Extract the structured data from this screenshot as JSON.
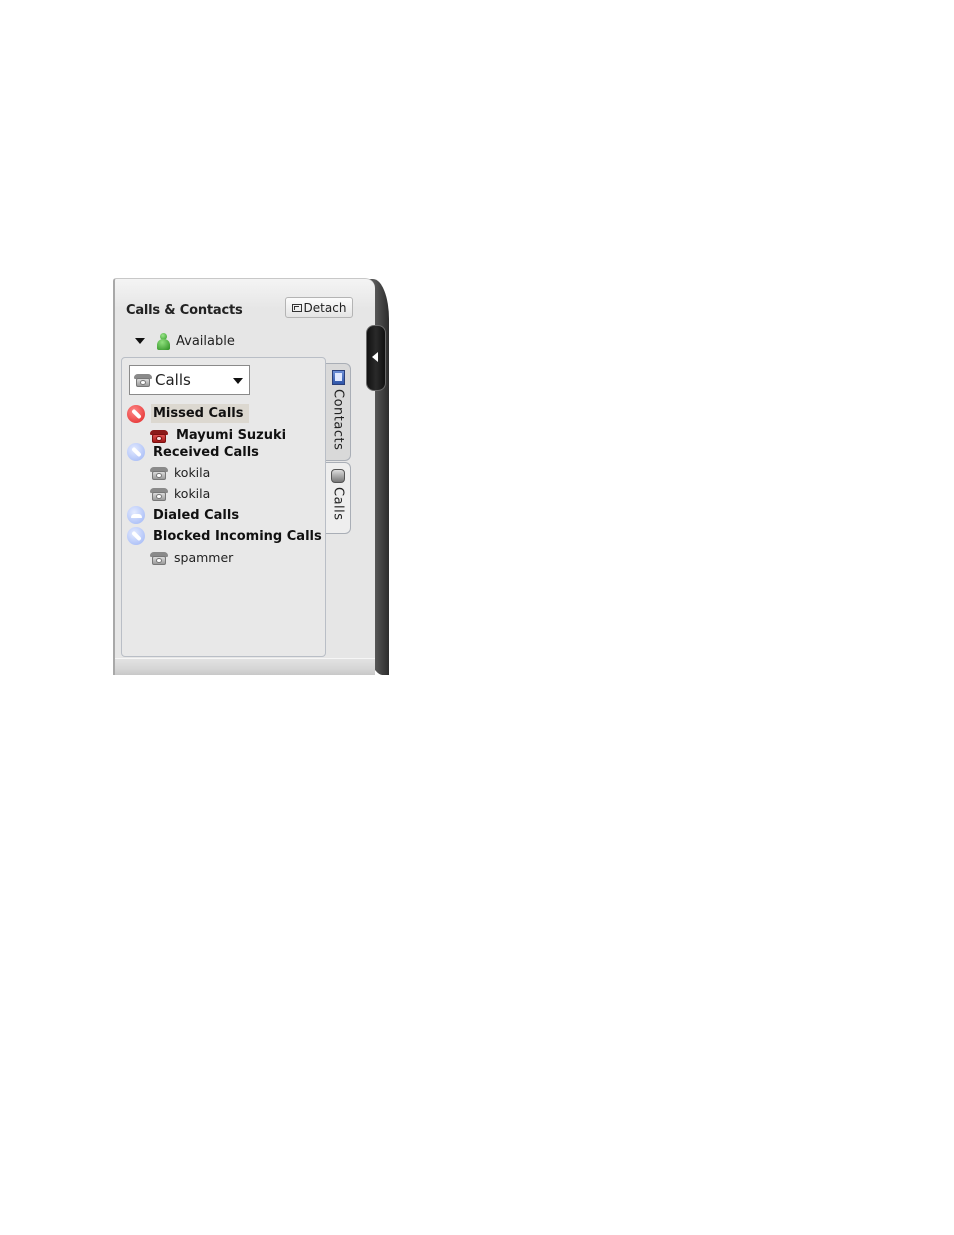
{
  "window": {
    "title": "Calls & Contacts",
    "detach_label": "Detach",
    "status": "Available"
  },
  "view_selector": {
    "selected": "Calls"
  },
  "tabs": [
    {
      "label": "Contacts",
      "active": false
    },
    {
      "label": "Calls",
      "active": true
    }
  ],
  "call_tree": {
    "missed": {
      "label": "Missed Calls",
      "items": [
        "Mayumi Suzuki"
      ]
    },
    "received": {
      "label": "Received Calls",
      "items": [
        "kokila",
        "kokila"
      ]
    },
    "dialed": {
      "label": "Dialed Calls",
      "items": []
    },
    "blocked": {
      "label": "Blocked Incoming Calls",
      "items": [
        "spammer"
      ]
    }
  },
  "colors": {
    "missed_accent": "#e02424",
    "call_category_accent": "#9db4f5",
    "status_available": "#2f9a24",
    "selection_bg": "#dcd8d0"
  }
}
